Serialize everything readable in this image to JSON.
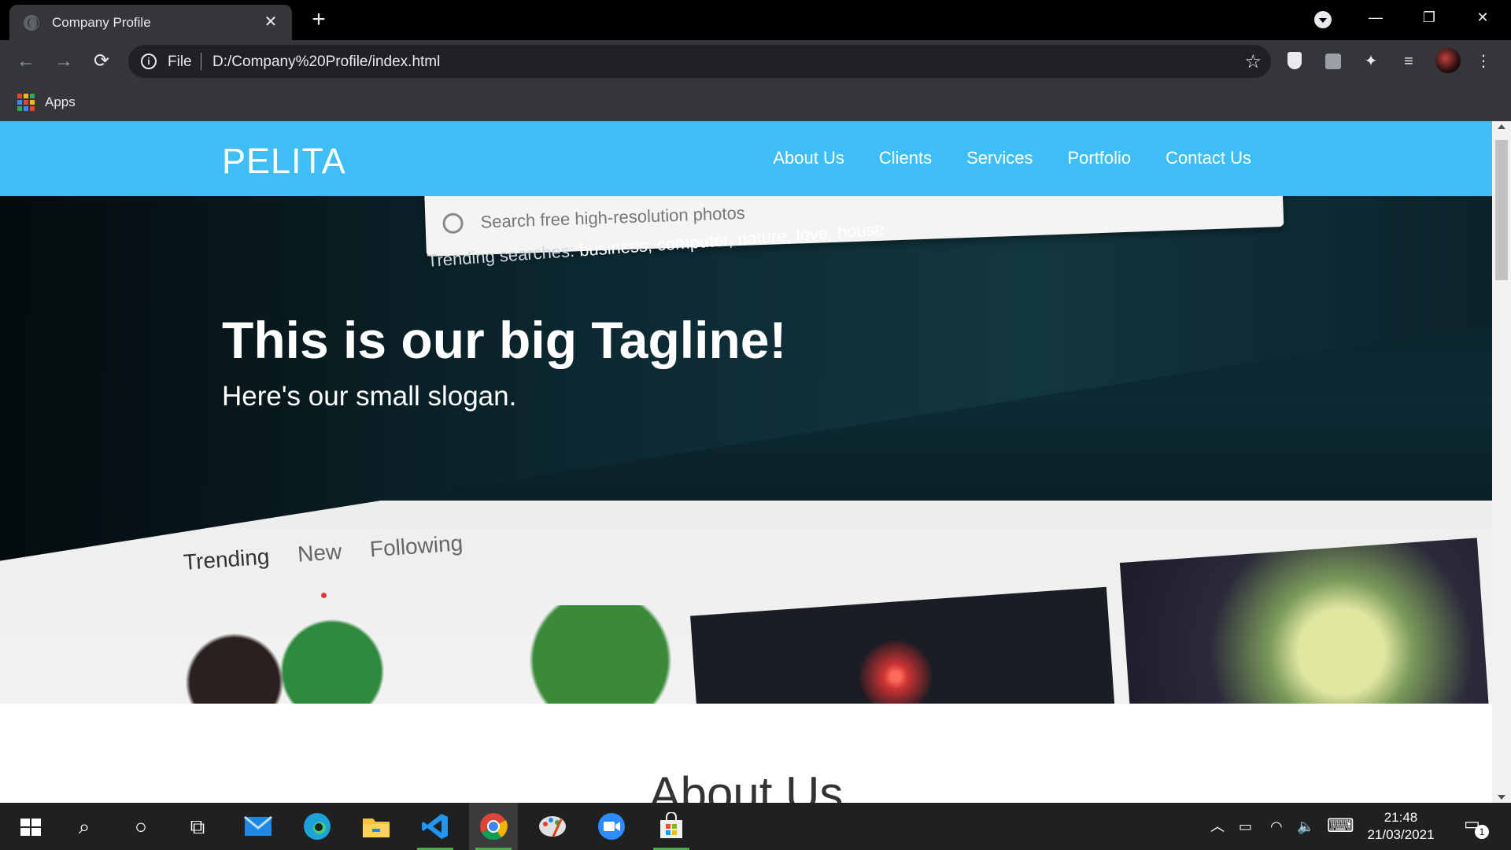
{
  "browser": {
    "tab": {
      "title": "Company Profile",
      "close": "✕"
    },
    "new_tab": "+",
    "window_controls": {
      "minimize": "—",
      "restore": "❐",
      "close": "✕"
    },
    "nav": {
      "back": "←",
      "forward": "→",
      "reload": "⟳"
    },
    "omnibox": {
      "scheme": "File",
      "url": "D:/Company%20Profile/index.html",
      "info": "i",
      "star": "☆"
    },
    "extensions": {
      "puzzle": "✦",
      "media": "≡",
      "menu": "⋮"
    },
    "bookmarks": {
      "apps_label": "Apps",
      "apps_colors": [
        "#ea4335",
        "#fbbc05",
        "#34a853",
        "#4285f4",
        "#ea4335",
        "#fbbc05",
        "#34a853",
        "#4285f4",
        "#ea4335"
      ]
    }
  },
  "site": {
    "brand": "PELITA",
    "menu": [
      "About Us",
      "Clients",
      "Services",
      "Portfolio",
      "Contact Us"
    ],
    "hero": {
      "tagline": "This is our big Tagline!",
      "slogan": "Here's our small slogan.",
      "photo_search_placeholder": "Search free high-resolution photos",
      "trending_label": "Trending searches:",
      "trending_terms": "business, computer, nature, love, house",
      "photo_tabs": [
        "Trending",
        "New",
        "Following"
      ]
    },
    "about_heading": "About Us"
  },
  "taskbar": {
    "search": "⌕",
    "cortana": "○",
    "taskview": "⧉",
    "apps": [
      "mail-icon",
      "edge-icon",
      "file-explorer-icon",
      "vscode-icon",
      "chrome-icon",
      "paint-icon",
      "zoom-icon",
      "store-icon"
    ],
    "tray": {
      "chevron": "︿",
      "battery": "▭",
      "wifi": "◠",
      "volume": "🔈",
      "keyboard": "⌨"
    },
    "time": "21:48",
    "date": "21/03/2021",
    "notifications": "1"
  }
}
